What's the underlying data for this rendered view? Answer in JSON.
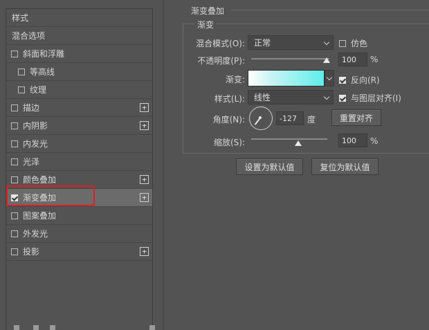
{
  "styles_panel": {
    "items": [
      {
        "label": "样式",
        "type": "header",
        "checked": null,
        "has_plus": false
      },
      {
        "label": "混合选项",
        "type": "header",
        "checked": null,
        "has_plus": false
      },
      {
        "label": "斜面和浮雕",
        "type": "item",
        "checked": false,
        "has_plus": false
      },
      {
        "label": "等高线",
        "type": "sub",
        "checked": false,
        "has_plus": false
      },
      {
        "label": "纹理",
        "type": "sub",
        "checked": false,
        "has_plus": false
      },
      {
        "label": "描边",
        "type": "item",
        "checked": false,
        "has_plus": true
      },
      {
        "label": "内阴影",
        "type": "item",
        "checked": false,
        "has_plus": true
      },
      {
        "label": "内发光",
        "type": "item",
        "checked": false,
        "has_plus": false
      },
      {
        "label": "光泽",
        "type": "item",
        "checked": false,
        "has_plus": false
      },
      {
        "label": "颜色叠加",
        "type": "item",
        "checked": false,
        "has_plus": true
      },
      {
        "label": "渐变叠加",
        "type": "item",
        "checked": true,
        "has_plus": true,
        "selected": true
      },
      {
        "label": "图案叠加",
        "type": "item",
        "checked": false,
        "has_plus": false
      },
      {
        "label": "外发光",
        "type": "item",
        "checked": false,
        "has_plus": false
      },
      {
        "label": "投影",
        "type": "item",
        "checked": false,
        "has_plus": true
      }
    ],
    "plus_symbol": "+",
    "highlight_color": "#e01f1f"
  },
  "gradient_overlay": {
    "section_title": "渐变叠加",
    "group_title": "渐变",
    "blend_mode_label": "混合模式(O):",
    "blend_mode_value": "正常",
    "dither_label": "仿色",
    "dither_checked": false,
    "opacity_label": "不透明度(P):",
    "opacity_value": "100",
    "opacity_unit": "%",
    "gradient_label": "渐变:",
    "gradient_colors": [
      "#ffffff",
      "#5eeeea"
    ],
    "reverse_label": "反向(R)",
    "reverse_checked": true,
    "style_label": "样式(L):",
    "style_value": "线性",
    "align_label": "与图层对齐(I)",
    "align_checked": true,
    "angle_label": "角度(N):",
    "angle_value": "-127",
    "angle_unit": "度",
    "reset_align_button": "重置对齐",
    "scale_label": "缩放(S):",
    "scale_value": "100",
    "scale_unit": "%",
    "make_default_button": "设置为默认值",
    "reset_default_button": "复位为默认值"
  }
}
